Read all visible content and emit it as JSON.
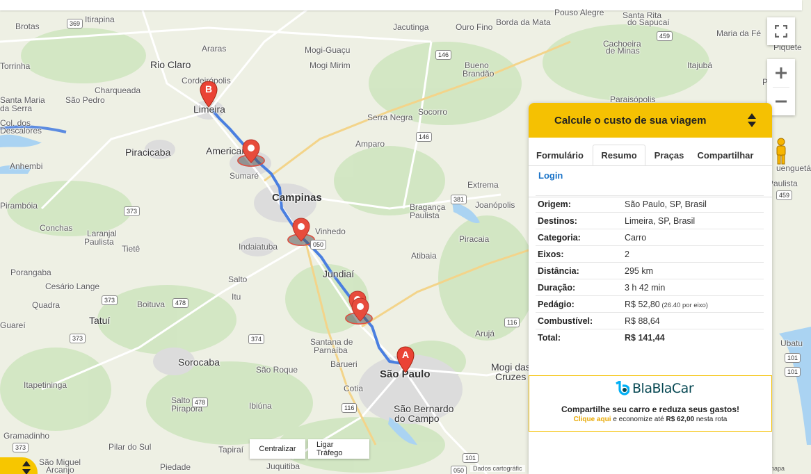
{
  "map": {
    "places": [
      {
        "name": "Brotas",
        "cls": ""
      },
      {
        "name": "Itirapina",
        "cls": ""
      },
      {
        "name": "Araras",
        "cls": ""
      },
      {
        "name": "Jacutinga",
        "cls": ""
      },
      {
        "name": "Ouro Fino",
        "cls": ""
      },
      {
        "name": "Borda da Mata",
        "cls": ""
      },
      {
        "name": "Pouso Alegre",
        "cls": ""
      },
      {
        "name": "Santa Rita",
        "cls": ""
      },
      {
        "name": "do Sapucaí",
        "cls": ""
      },
      {
        "name": "Itajubá",
        "cls": ""
      },
      {
        "name": "Maria da Fé",
        "cls": ""
      },
      {
        "name": "Cachoeira",
        "cls": ""
      },
      {
        "name": "de Minas",
        "cls": ""
      },
      {
        "name": "Mogi-Guaçu",
        "cls": ""
      },
      {
        "name": "Mogi Mirim",
        "cls": ""
      },
      {
        "name": "Bueno",
        "cls": ""
      },
      {
        "name": "Brandão",
        "cls": ""
      },
      {
        "name": "Rio Claro",
        "cls": "big"
      },
      {
        "name": "Torrinha",
        "cls": ""
      },
      {
        "name": "Cordeirópolis",
        "cls": ""
      },
      {
        "name": "Charqueada",
        "cls": ""
      },
      {
        "name": "São Pedro",
        "cls": ""
      },
      {
        "name": "Santa Maria",
        "cls": ""
      },
      {
        "name": "da Serra",
        "cls": ""
      },
      {
        "name": "Limeira",
        "cls": "big"
      },
      {
        "name": "Socorro",
        "cls": ""
      },
      {
        "name": "Serra Negra",
        "cls": ""
      },
      {
        "name": "Paraisópolis",
        "cls": ""
      },
      {
        "name": "Col. dos",
        "cls": ""
      },
      {
        "name": "Descalores",
        "cls": ""
      },
      {
        "name": "Piracicaba",
        "cls": "big"
      },
      {
        "name": "Americana",
        "cls": "big"
      },
      {
        "name": "Amparo",
        "cls": ""
      },
      {
        "name": "Anhembi",
        "cls": ""
      },
      {
        "name": "Sumaré",
        "cls": ""
      },
      {
        "name": "Extrema",
        "cls": ""
      },
      {
        "name": "Pirambóia",
        "cls": ""
      },
      {
        "name": "Campinas",
        "cls": "city"
      },
      {
        "name": "Bragança",
        "cls": ""
      },
      {
        "name": "Paulista",
        "cls": ""
      },
      {
        "name": "Joanópolis",
        "cls": ""
      },
      {
        "name": "Conchas",
        "cls": ""
      },
      {
        "name": "Laranjal",
        "cls": ""
      },
      {
        "name": "Paulista",
        "cls": ""
      },
      {
        "name": "Vinhedo",
        "cls": ""
      },
      {
        "name": "Piracaia",
        "cls": ""
      },
      {
        "name": "Tietê",
        "cls": ""
      },
      {
        "name": "Indaiatuba",
        "cls": ""
      },
      {
        "name": "Porangaba",
        "cls": ""
      },
      {
        "name": "Atibaia",
        "cls": ""
      },
      {
        "name": "Salto",
        "cls": ""
      },
      {
        "name": "Jundiaí",
        "cls": "big"
      },
      {
        "name": "Cesário Lange",
        "cls": ""
      },
      {
        "name": "Itu",
        "cls": ""
      },
      {
        "name": "Quadra",
        "cls": ""
      },
      {
        "name": "Boituva",
        "cls": ""
      },
      {
        "name": "Tatuí",
        "cls": "big"
      },
      {
        "name": "Guareí",
        "cls": ""
      },
      {
        "name": "Arujá",
        "cls": ""
      },
      {
        "name": "Santana de",
        "cls": ""
      },
      {
        "name": "Parnaíba",
        "cls": ""
      },
      {
        "name": "Sorocaba",
        "cls": "big"
      },
      {
        "name": "Barueri",
        "cls": ""
      },
      {
        "name": "São Roque",
        "cls": ""
      },
      {
        "name": "São Paulo",
        "cls": "city"
      },
      {
        "name": "Mogi das",
        "cls": "big"
      },
      {
        "name": "Cruzes",
        "cls": "big"
      },
      {
        "name": "Itapetininga",
        "cls": ""
      },
      {
        "name": "Salto de",
        "cls": ""
      },
      {
        "name": "Pirapora",
        "cls": ""
      },
      {
        "name": "Cotia",
        "cls": ""
      },
      {
        "name": "Ibiúna",
        "cls": ""
      },
      {
        "name": "São Bernardo",
        "cls": "big"
      },
      {
        "name": "do Campo",
        "cls": "big"
      },
      {
        "name": "Gramadinho",
        "cls": ""
      },
      {
        "name": "Pilar do Sul",
        "cls": ""
      },
      {
        "name": "Tapiraí",
        "cls": ""
      },
      {
        "name": "Juquitiba",
        "cls": ""
      },
      {
        "name": "São Miguel",
        "cls": ""
      },
      {
        "name": "Arcanjo",
        "cls": ""
      },
      {
        "name": "Piedade",
        "cls": ""
      },
      {
        "name": "Ubatu",
        "cls": ""
      },
      {
        "name": "Piquete",
        "cls": ""
      },
      {
        "name": "uenguetá",
        "cls": ""
      },
      {
        "name": "Paulista",
        "cls": ""
      },
      {
        "name": "Paraíso",
        "cls": ""
      }
    ],
    "shields": [
      "369",
      "146",
      "459",
      "146",
      "373",
      "381",
      "050",
      "373",
      "478",
      "116",
      "374",
      "373",
      "478",
      "116",
      "101",
      "373",
      "101",
      "050",
      "459",
      "101"
    ],
    "markers": {
      "a": "A",
      "b": "B"
    },
    "buttons": {
      "center": "Centralizar",
      "traffic": "Ligar Tráfego"
    },
    "attribution": "Dados cartográfic",
    "attribution_right": "o mapa"
  },
  "panel": {
    "title": "Calcule o custo de sua viagem",
    "tabs": [
      "Formulário",
      "Resumo",
      "Praças",
      "Compartilhar"
    ],
    "login": "Login",
    "rows": [
      {
        "k": "Origem:",
        "v": "São Paulo, SP, Brasil"
      },
      {
        "k": "Destinos:",
        "v": "Limeira, SP, Brasil"
      },
      {
        "k": "Categoria:",
        "v": "Carro"
      },
      {
        "k": "Eixos:",
        "v": "2"
      },
      {
        "k": "Distância:",
        "v": "295 km"
      },
      {
        "k": "Duração:",
        "v": "3 h 42 min"
      },
      {
        "k": "Pedágio:",
        "v": "R$ 52,80",
        "small": "(26.40 por eixo)"
      },
      {
        "k": "Combustível:",
        "v": "R$ 88,64"
      },
      {
        "k": "Total:",
        "v": "R$ 141,44"
      }
    ],
    "promo": {
      "brand": "BlaBlaCar",
      "headline": "Compartilhe seu carro e reduza seus gastos!",
      "link": "Clique aqui",
      "middle": " e economize até ",
      "amount": "R$ 62,00",
      "tail": " nesta rota"
    }
  },
  "colors": {
    "accent": "#f5c102",
    "route": "#4a7fe0",
    "marker": "#e74c3c",
    "link": "#1a73c8"
  }
}
